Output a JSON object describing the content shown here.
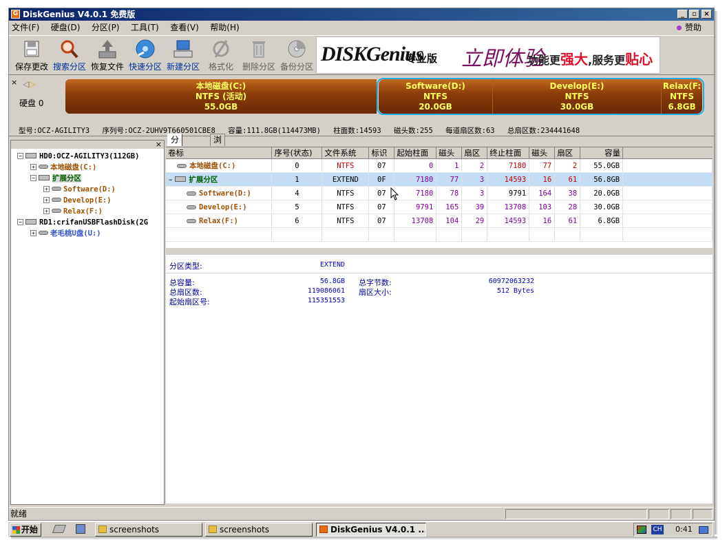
{
  "window": {
    "title": "DiskGenius V4.0.1 免费版",
    "min": "_",
    "max": "▫",
    "close": "×"
  },
  "menu": {
    "items": [
      "文件(F)",
      "硬盘(D)",
      "分区(P)",
      "工具(T)",
      "查看(V)",
      "帮助(H)"
    ],
    "sponsor": "赞助"
  },
  "toolbar": {
    "items": [
      {
        "label": "保存更改",
        "icon": "save-icon"
      },
      {
        "label": "搜索分区",
        "icon": "search-icon"
      },
      {
        "label": "恢复文件",
        "icon": "restore-icon"
      },
      {
        "label": "快速分区",
        "icon": "quick-partition-icon"
      },
      {
        "label": "新建分区",
        "icon": "new-partition-icon"
      },
      {
        "label": "格式化",
        "icon": "format-icon"
      },
      {
        "label": "删除分区",
        "icon": "delete-icon"
      },
      {
        "label": "备份分区",
        "icon": "backup-icon"
      }
    ],
    "banner": {
      "logo": "DISKGenius",
      "edition": "专业版",
      "script": "立即体验",
      "slogan_a": "功能更",
      "slogan_b": "强大",
      "slogan_c": ",服务更",
      "slogan_d": "贴心"
    }
  },
  "disk": {
    "label": "硬盘 0",
    "close": "×",
    "partitions": [
      {
        "name": "本地磁盘(C:)",
        "fs": "NTFS (活动)",
        "size": "55.0GB"
      },
      {
        "name": "Software(D:)",
        "fs": "NTFS",
        "size": "20.0GB"
      },
      {
        "name": "Develop(E:)",
        "fs": "NTFS",
        "size": "30.0GB"
      },
      {
        "name": "Relax(F:",
        "fs": "NTFS",
        "size": "6.8GB"
      }
    ],
    "info": [
      "型号:OCZ-AGILITY3",
      "序列号:OCZ-2UHV9T660501CBE8",
      "容量:111.8GB(114473MB)",
      "柱面数:14593",
      "磁头数:255",
      "每道扇区数:63",
      "总扇区数:234441648"
    ]
  },
  "tree": {
    "close": "×",
    "nodes": [
      {
        "text": "HD0:OCZ-AGILITY3(112GB)",
        "pm": "−",
        "kind": "disk",
        "color": "#000000"
      },
      {
        "text": "本地磁盘(C:)",
        "pm": "+",
        "kind": "vol",
        "color": "#a05000"
      },
      {
        "text": "扩展分区",
        "pm": "−",
        "kind": "disk",
        "color": "#006000"
      },
      {
        "text": "Software(D:)",
        "pm": "+",
        "kind": "vol",
        "color": "#a05000"
      },
      {
        "text": "Develop(E:)",
        "pm": "+",
        "kind": "vol",
        "color": "#a05000"
      },
      {
        "text": "Relax(F:)",
        "pm": "+",
        "kind": "vol",
        "color": "#a05000"
      },
      {
        "text": "RD1:crifanUSBFlashDisk(2G",
        "pm": "−",
        "kind": "disk",
        "color": "#000000"
      },
      {
        "text": "老毛桃U盘(U:)",
        "pm": "+",
        "kind": "vol",
        "color": "#3050d0"
      }
    ]
  },
  "tabs": [
    "分区参数",
    "浏览文件"
  ],
  "table": {
    "headers": [
      "卷标",
      "序号(状态)",
      "文件系统",
      "标识",
      "起始柱面",
      "磁头",
      "扇区",
      "终止柱面",
      "磁头",
      "扇区",
      "容量"
    ],
    "rows": [
      {
        "name": "本地磁盘(C:)",
        "no": "0",
        "fs": "NTFS",
        "id": "07",
        "sc": "0",
        "sh": "1",
        "ss": "2",
        "ec": "7180",
        "eh": "77",
        "es": "2",
        "cap": "55.0GB"
      },
      {
        "name": "扩展分区",
        "no": "1",
        "fs": "EXTEND",
        "id": "0F",
        "sc": "7180",
        "sh": "77",
        "ss": "3",
        "ec": "14593",
        "eh": "16",
        "es": "61",
        "cap": "56.8GB"
      },
      {
        "name": "Software(D:)",
        "no": "4",
        "fs": "NTFS",
        "id": "07",
        "sc": "7180",
        "sh": "78",
        "ss": "3",
        "ec": "9791",
        "eh": "164",
        "es": "38",
        "cap": "20.0GB"
      },
      {
        "name": "Develop(E:)",
        "no": "5",
        "fs": "NTFS",
        "id": "07",
        "sc": "9791",
        "sh": "165",
        "ss": "39",
        "ec": "13708",
        "eh": "103",
        "es": "28",
        "cap": "30.0GB"
      },
      {
        "name": "Relax(F:)",
        "no": "6",
        "fs": "NTFS",
        "id": "07",
        "sc": "13708",
        "sh": "104",
        "ss": "29",
        "ec": "14593",
        "eh": "16",
        "es": "61",
        "cap": "6.8GB"
      }
    ]
  },
  "details": {
    "type_label": "分区类型:",
    "type_value": "EXTEND",
    "total_cap_label": "总容量:",
    "total_cap": "56.8GB",
    "total_sec_label": "总扇区数:",
    "total_sec": "119086061",
    "start_sec_label": "起始扇区号:",
    "start_sec": "115351553",
    "total_bytes_label": "总字节数:",
    "total_bytes": "60972063232",
    "sector_size_label": "扇区大小:",
    "sector_size": "512 Bytes"
  },
  "status": {
    "text": "就绪"
  },
  "taskbar": {
    "start": "开始",
    "tasks": [
      {
        "label": "screenshots"
      },
      {
        "label": "screenshots"
      },
      {
        "label": "DiskGenius V4.0.1 ..."
      }
    ],
    "lang": "CH",
    "clock": "0:41"
  }
}
